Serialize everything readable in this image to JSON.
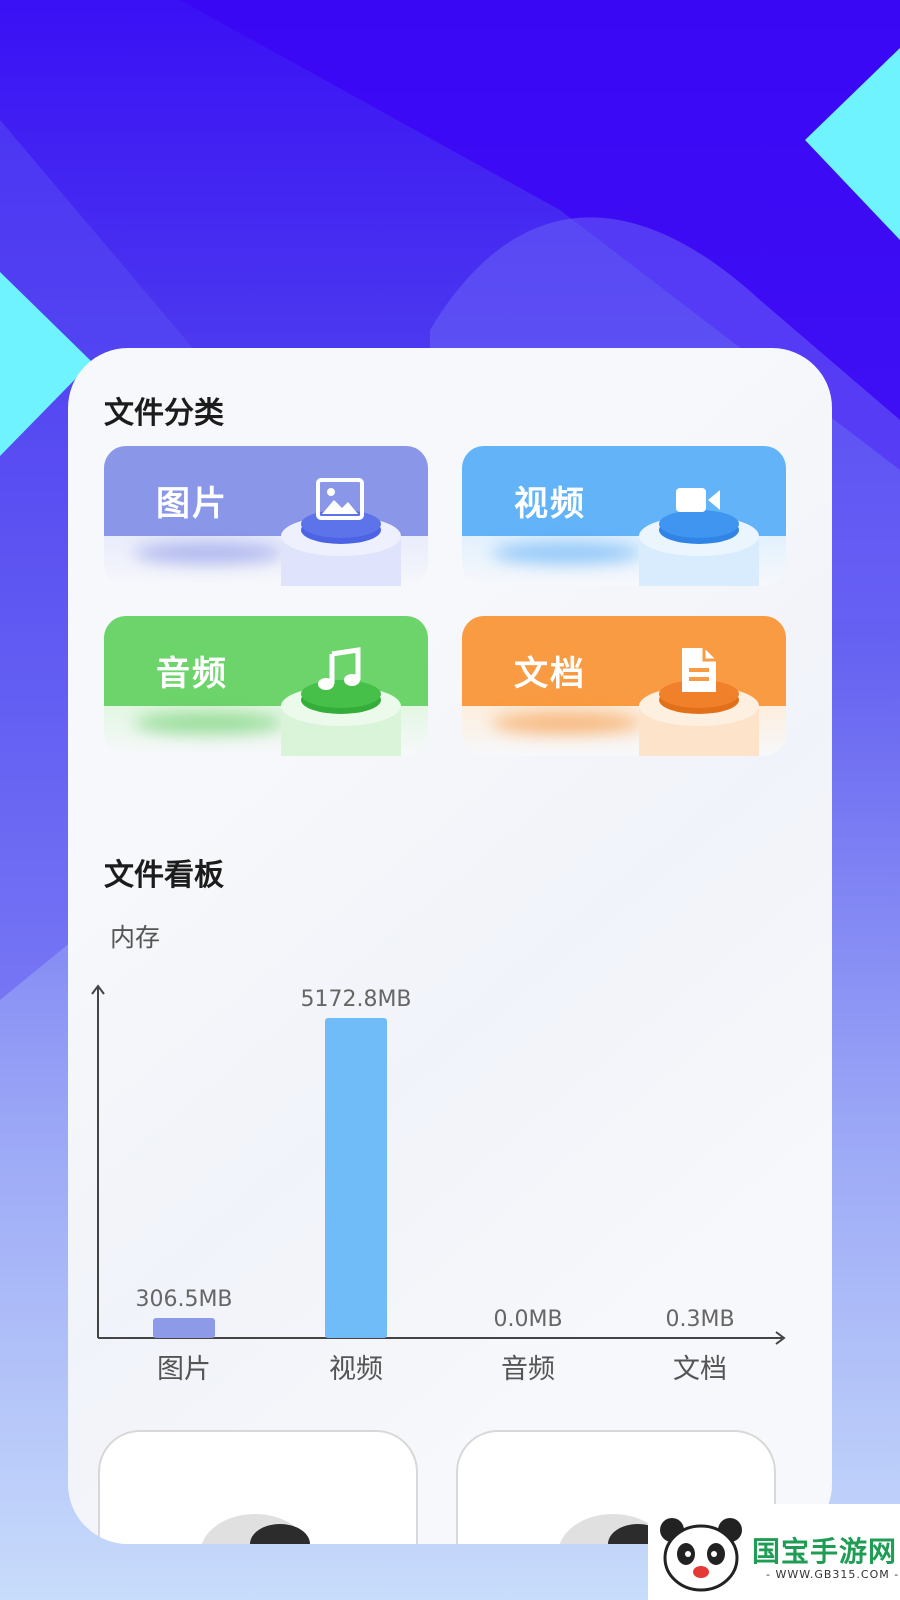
{
  "colors": {
    "image_tile": "#8a97e8",
    "video_tile": "#62b3f8",
    "audio_tile": "#6dd46b",
    "doc_tile": "#f99b42",
    "bar_image": "#8c9ae8",
    "bar_video": "#6fbcf9"
  },
  "categories": {
    "title": "文件分类",
    "items": [
      {
        "label": "图片",
        "icon": "image-icon"
      },
      {
        "label": "视频",
        "icon": "video-camera-icon"
      },
      {
        "label": "音频",
        "icon": "music-note-icon"
      },
      {
        "label": "文档",
        "icon": "document-icon"
      }
    ]
  },
  "board": {
    "title": "文件看板"
  },
  "chart_data": {
    "type": "bar",
    "ylabel": "内存",
    "categories": [
      "图片",
      "视频",
      "音频",
      "文档"
    ],
    "values": [
      306.5,
      5172.8,
      0.0,
      0.3
    ],
    "value_labels": [
      "306.5MB",
      "5172.8MB",
      "0.0MB",
      "0.3MB"
    ],
    "unit": "MB",
    "ylim": [
      0,
      5172.8
    ]
  },
  "watermark": {
    "text": "国宝手游网",
    "sub": "- WWW.GB315.COM -"
  }
}
